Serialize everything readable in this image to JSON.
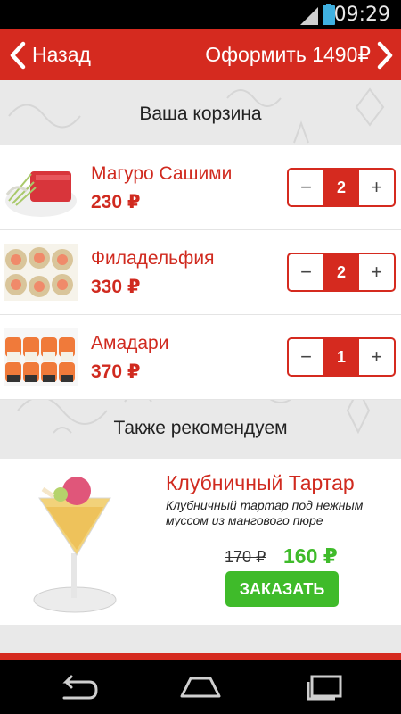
{
  "status_bar": {
    "time": "09:29",
    "signal_icon": "signal-icon",
    "battery_icon": "battery-icon"
  },
  "header": {
    "back_label": "Назад",
    "checkout_label": "Оформить 1490₽",
    "colors": {
      "brand": "#d52a1f"
    }
  },
  "cart": {
    "title": "Ваша корзина",
    "items": [
      {
        "name": "Магуро Сашими",
        "price": "230 ₽",
        "qty": "2",
        "minus": "−",
        "plus": "+"
      },
      {
        "name": "Филадельфия",
        "price": "330 ₽",
        "qty": "2",
        "minus": "−",
        "plus": "+"
      },
      {
        "name": "Амадари",
        "price": "370 ₽",
        "qty": "1",
        "minus": "−",
        "plus": "+"
      }
    ]
  },
  "recommend": {
    "title": "Также рекомендуем",
    "item": {
      "name": "Клубничный Тартар",
      "description": "Клубничный тартар под нежным муссом из мангового пюре",
      "old_price": "170 ₽",
      "new_price": "160 ₽",
      "order_label": "ЗАКАЗАТЬ"
    },
    "colors": {
      "accent": "#3fbb2a"
    }
  }
}
